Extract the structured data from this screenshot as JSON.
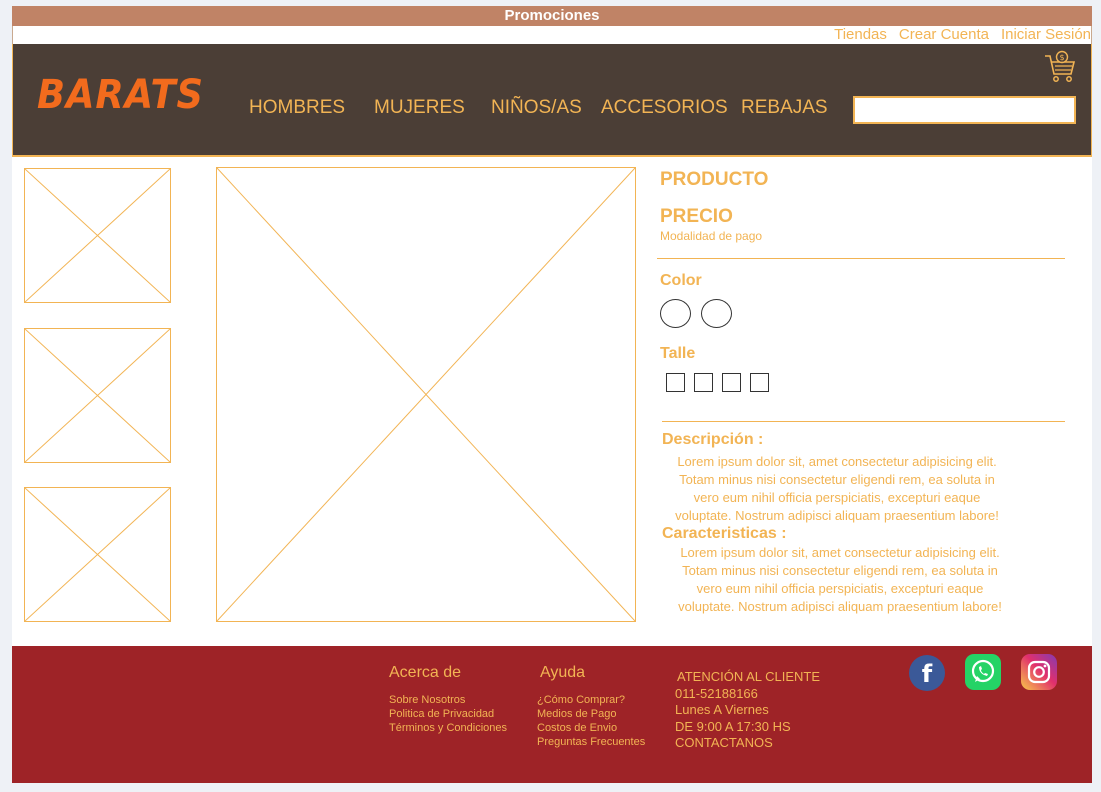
{
  "promo": {
    "label": "Promociones"
  },
  "top_links": [
    "Tiendas",
    "Crear Cuenta",
    "Iniciar Sesión"
  ],
  "header": {
    "logo": "BARATS",
    "nav": [
      "HOMBRES",
      "MUJERES",
      "NIÑOS/AS",
      "ACCESORIOS",
      "REBAJAS"
    ],
    "search": {
      "placeholder": "",
      "value": ""
    }
  },
  "product": {
    "name": "PRODUCTO",
    "price": "PRECIO",
    "payment": "Modalidad de pago",
    "color_label": "Color",
    "size_label": "Talle",
    "description_label": "Descripción :",
    "description": [
      "Lorem ipsum dolor sit, amet consectetur adipisicing elit.",
      "Totam minus nisi consectetur eligendi rem, ea soluta in",
      "vero eum nihil officia perspiciatis, excepturi eaque",
      "voluptate. Nostrum adipisci aliquam praesentium labore!"
    ],
    "features_label": "Caracteristicas :",
    "features": [
      "Lorem ipsum dolor sit, amet consectetur adipisicing elit.",
      "Totam minus nisi consectetur eligendi rem, ea soluta in",
      "vero eum nihil officia perspiciatis, excepturi eaque",
      "voluptate. Nostrum adipisci aliquam praesentium labore!"
    ]
  },
  "footer": {
    "about": {
      "title": "Acerca de",
      "links": [
        "Sobre Nosotros",
        "Politica de Privacidad",
        "Términos y Condiciones"
      ]
    },
    "help": {
      "title": "Ayuda",
      "links": [
        "¿Cómo Comprar?",
        "Medios de Pago",
        "Costos de Envio",
        "Preguntas Frecuentes"
      ]
    },
    "contact": [
      "ATENCIÓN AL CLIENTE",
      "011-52188166",
      "Lunes A Viernes",
      "DE 9:00 A 17:30 HS",
      "CONTACTANOS"
    ],
    "social_icons": [
      "facebook-icon",
      "whatsapp-icon",
      "instagram-icon"
    ]
  },
  "colors": {
    "accent": "#f2b454",
    "header_bg": "#4b3e36",
    "footer_bg": "#9e2327",
    "logo": "#f26b1d",
    "promo_bg": "#c08366"
  }
}
